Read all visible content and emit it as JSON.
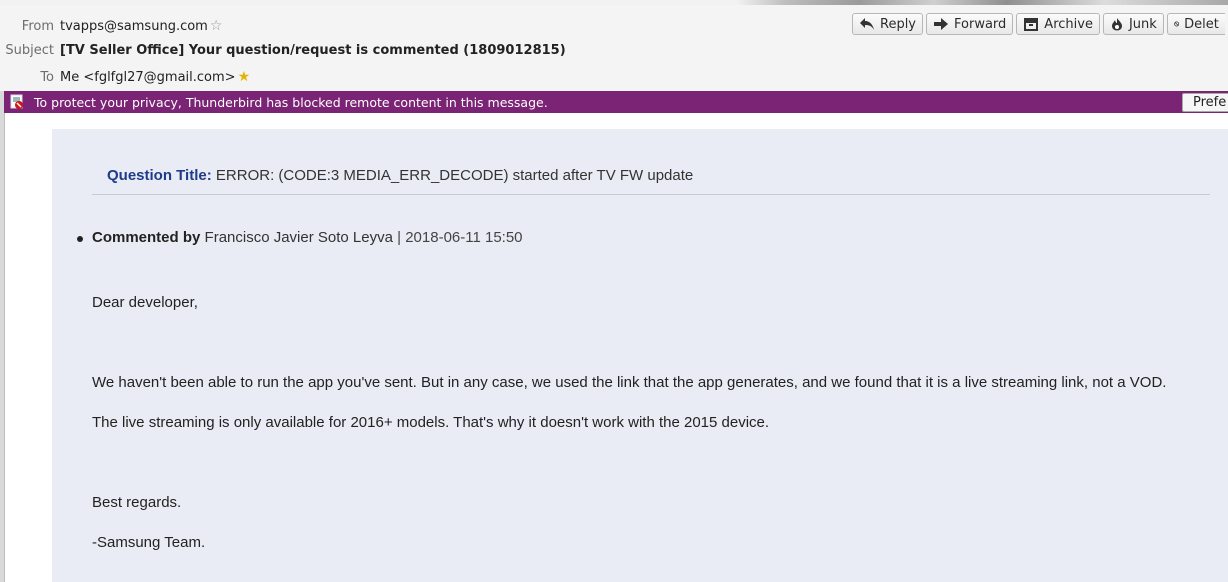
{
  "header": {
    "from_label": "From",
    "from_value": "tvapps@samsung.com",
    "subject_label": "Subject",
    "subject_value": "[TV Seller Office] Your question/request is commented (1809012815)",
    "to_label": "To",
    "to_value": "Me <fglfgl27@gmail.com>"
  },
  "toolbar": {
    "reply": "Reply",
    "forward": "Forward",
    "archive": "Archive",
    "junk": "Junk",
    "delete": "Delet"
  },
  "notice": {
    "text": "To protect your privacy, Thunderbird has blocked remote content in this message.",
    "button": "Prefe"
  },
  "message": {
    "question_label": "Question Title:",
    "question_text": "ERROR: (CODE:3 MEDIA_ERR_DECODE) started after TV FW update",
    "commented_label": "Commented by",
    "commenter": "Francisco Javier Soto Leyva",
    "separator": "|",
    "datetime": "2018-06-11 15:50",
    "greeting": "Dear developer,",
    "para1": "We haven't been able to run the app you've sent. But in any case, we used the link that the app generates, and we found that it is a live streaming link, not a VOD.",
    "para2": "The live streaming is only available for 2016+ models. That's why it doesn't work with the 2015 device.",
    "closing": "Best regards.",
    "signature": "-Samsung Team."
  },
  "colors": {
    "notice_bg": "#7b2374",
    "message_bg": "#e9ecf4",
    "question_label": "#1f3b8a"
  }
}
